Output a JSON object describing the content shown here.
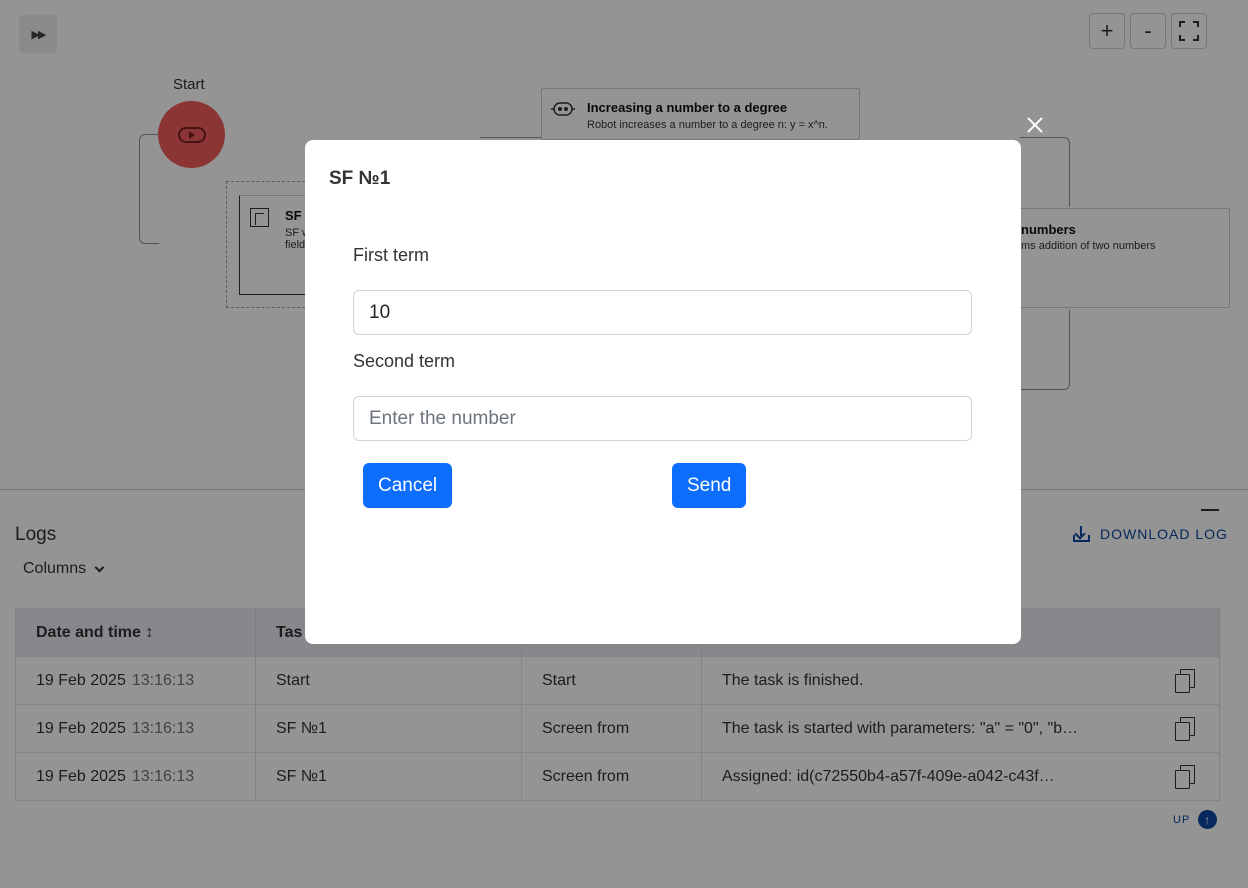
{
  "flow": {
    "panel_toggle_icon": "fast-forward-icon",
    "zoom_in": "+",
    "zoom_out": "-",
    "start_label": "Start",
    "power_node": {
      "title": "Increasing a number to a degree",
      "desc": "Robot increases a number to a degree n: y = x^n."
    },
    "sf_node": {
      "title": "SF",
      "desc_line1": "SF w",
      "desc_line2": "field"
    },
    "add_node": {
      "title": "numbers",
      "desc": "ms addition of two numbers"
    }
  },
  "logs": {
    "title": "Logs",
    "columns_label": "Columns",
    "download_label": "DOWNLOAD LOG",
    "up_label": "UP",
    "headers": [
      "Date and time ↕",
      "Tas",
      "",
      ""
    ],
    "rows": [
      {
        "date": "19 Feb 2025",
        "time": "13:16:13",
        "task": "Start",
        "type": "Start",
        "message": "The task is finished."
      },
      {
        "date": "19 Feb 2025",
        "time": "13:16:13",
        "task": "SF №1",
        "type": "Screen from",
        "message": "The task is started with parameters: \"a\" = \"0\", \"b…"
      },
      {
        "date": "19 Feb 2025",
        "time": "13:16:13",
        "task": "SF №1",
        "type": "Screen from",
        "message": "Assigned: id(c72550b4-a57f-409e-a042-c43f…"
      }
    ]
  },
  "modal": {
    "title": "SF №1",
    "first_label": "First term",
    "first_value": "10",
    "second_label": "Second term",
    "second_placeholder": "Enter the number",
    "cancel_label": "Cancel",
    "send_label": "Send"
  },
  "colors": {
    "primary": "#0d6efd",
    "start_node": "#f25c5c",
    "link": "#0d47a1"
  }
}
